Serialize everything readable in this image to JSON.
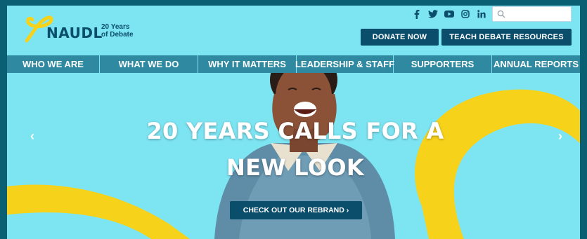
{
  "brand": {
    "name": "NAUDL",
    "tagline_line1": "20 Years",
    "tagline_line2": "of Debate"
  },
  "header": {
    "social_icons": [
      "facebook-icon",
      "twitter-icon",
      "youtube-icon",
      "instagram-icon",
      "linkedin-icon"
    ],
    "search": {
      "placeholder": ""
    },
    "donate_label": "DONATE NOW",
    "teach_label": "TEACH DEBATE RESOURCES"
  },
  "nav": {
    "items": [
      {
        "label": "WHO WE ARE"
      },
      {
        "label": "WHAT WE DO"
      },
      {
        "label": "WHY IT MATTERS"
      },
      {
        "label": "LEADERSHIP & STAFF"
      },
      {
        "label": "SUPPORTERS"
      },
      {
        "label": "ANNUAL REPORTS"
      }
    ]
  },
  "hero": {
    "headline_line1": "20 YEARS CALLS FOR A",
    "headline_line2": "NEW LOOK",
    "cta_label": "CHECK OUT OUR REBRAND ›",
    "prev_glyph": "‹",
    "next_glyph": "›"
  },
  "colors": {
    "background": "#7de4f2",
    "brand_dark": "#0b4e6c",
    "nav": "#2f8aa1",
    "accent_yellow": "#f7d21a",
    "frame": "#0b5f73"
  }
}
